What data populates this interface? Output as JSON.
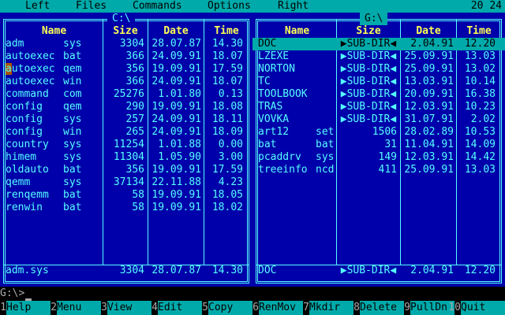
{
  "menu": {
    "items": [
      "Left",
      "Files",
      "Commands",
      "Options",
      "Right"
    ],
    "clock": "20 24"
  },
  "left_panel": {
    "title": "C:\\",
    "active": false,
    "columns": {
      "name": "Name",
      "size": "Size",
      "date": "Date",
      "time": "Time"
    },
    "files": [
      {
        "name": "adm",
        "ext": "sys",
        "size": "3304",
        "date": "28.07.87",
        "time": "14.30"
      },
      {
        "name": "autoexec",
        "ext": "bat",
        "size": "366",
        "date": "24.09.91",
        "time": "18.07"
      },
      {
        "name": "autoexec",
        "ext": "qem",
        "size": "356",
        "date": "19.09.91",
        "time": "17.59"
      },
      {
        "name": "autoexec",
        "ext": "win",
        "size": "366",
        "date": "24.09.91",
        "time": "18.07"
      },
      {
        "name": "command",
        "ext": "com",
        "size": "25276",
        "date": "1.01.80",
        "time": "0.13"
      },
      {
        "name": "config",
        "ext": "qem",
        "size": "290",
        "date": "19.09.91",
        "time": "18.08"
      },
      {
        "name": "config",
        "ext": "sys",
        "size": "257",
        "date": "24.09.91",
        "time": "18.11"
      },
      {
        "name": "config",
        "ext": "win",
        "size": "265",
        "date": "24.09.91",
        "time": "18.09"
      },
      {
        "name": "country",
        "ext": "sys",
        "size": "11254",
        "date": "1.01.88",
        "time": "0.00"
      },
      {
        "name": "himem",
        "ext": "sys",
        "size": "11304",
        "date": "1.05.90",
        "time": "3.00"
      },
      {
        "name": "oldauto",
        "ext": "bat",
        "size": "356",
        "date": "19.09.91",
        "time": "17.59"
      },
      {
        "name": "qemm",
        "ext": "sys",
        "size": "37134",
        "date": "22.11.88",
        "time": "4.23"
      },
      {
        "name": "renqemm",
        "ext": "bat",
        "size": "58",
        "date": "19.09.91",
        "time": "18.05"
      },
      {
        "name": "renwin",
        "ext": "bat",
        "size": "58",
        "date": "19.09.91",
        "time": "18.02"
      }
    ],
    "status": {
      "name": "adm.sys",
      "size": "3304",
      "date": "28.07.87",
      "time": "14.30"
    }
  },
  "right_panel": {
    "title": "G:\\",
    "active": true,
    "columns": {
      "name": "Name",
      "size": "Size",
      "date": "Date",
      "time": "Time"
    },
    "files": [
      {
        "name": "DOC",
        "ext": "",
        "size": "▶SUB-DIR◀",
        "date": "2.04.91",
        "time": "12.20",
        "dir": true
      },
      {
        "name": "LZEXE",
        "ext": "",
        "size": "▶SUB-DIR◀",
        "date": "25.09.91",
        "time": "13.03",
        "dir": true
      },
      {
        "name": "NORTON",
        "ext": "",
        "size": "▶SUB-DIR◀",
        "date": "25.09.91",
        "time": "13.02",
        "dir": true
      },
      {
        "name": "TC",
        "ext": "",
        "size": "▶SUB-DIR◀",
        "date": "13.03.91",
        "time": "10.14",
        "dir": true
      },
      {
        "name": "TOOLBOOK",
        "ext": "",
        "size": "▶SUB-DIR◀",
        "date": "20.09.91",
        "time": "16.38",
        "dir": true
      },
      {
        "name": "TRAS",
        "ext": "",
        "size": "▶SUB-DIR◀",
        "date": "12.03.91",
        "time": "10.23",
        "dir": true
      },
      {
        "name": "VOVKA",
        "ext": "",
        "size": "▶SUB-DIR◀",
        "date": "31.07.91",
        "time": "2.02",
        "dir": true
      },
      {
        "name": "art12",
        "ext": "set",
        "size": "1506",
        "date": "28.02.89",
        "time": "10.53"
      },
      {
        "name": "bat",
        "ext": "bat",
        "size": "31",
        "date": "11.04.91",
        "time": "14.09"
      },
      {
        "name": "pcaddrv",
        "ext": "sys",
        "size": "149",
        "date": "12.03.91",
        "time": "14.42"
      },
      {
        "name": "treeinfo",
        "ext": "ncd",
        "size": "411",
        "date": "25.09.91",
        "time": "13.03"
      }
    ],
    "status": {
      "name": "DOC",
      "size": "▶SUB-DIR◀",
      "date": "2.04.91",
      "time": "12.20"
    }
  },
  "command_line": {
    "prompt": "G:\\>"
  },
  "fkeys": [
    {
      "num": "1",
      "label": "Help"
    },
    {
      "num": "2",
      "label": "Menu"
    },
    {
      "num": "3",
      "label": "View"
    },
    {
      "num": "4",
      "label": "Edit"
    },
    {
      "num": "5",
      "label": "Copy"
    },
    {
      "num": "6",
      "label": "RenMov"
    },
    {
      "num": "7",
      "label": "Mkdir"
    },
    {
      "num": "8",
      "label": "Delete"
    },
    {
      "num": "9",
      "label": "PullDn"
    },
    {
      "num": "10",
      "label": "Quit"
    }
  ],
  "colors": {
    "panel_bg": "#0000aa",
    "frame": "#55ffff",
    "header_text": "#ffff55",
    "highlight_bar": "#00aaaa",
    "selected_char": "#aa5500"
  }
}
